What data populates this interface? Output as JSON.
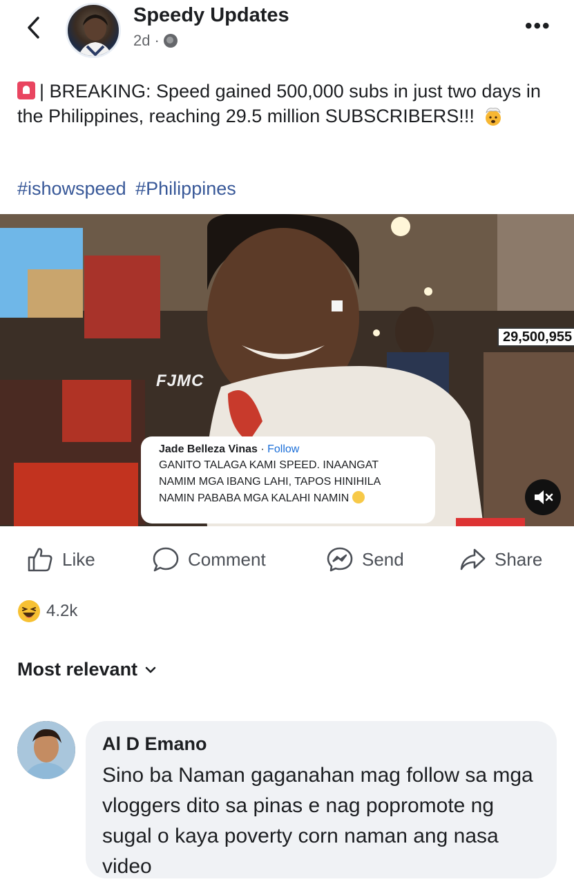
{
  "header": {
    "page_name": "Speedy Updates",
    "time": "2d",
    "separator": "·",
    "back_icon": "chevron-left-icon",
    "privacy_icon": "globe-icon",
    "more_label": "•••"
  },
  "post": {
    "text": "| BREAKING: Speed gained 500,000 subs in just two days in the Philippines, reaching 29.5 million SUBSCRIBERS!!!",
    "lead_icon": "siren-icon",
    "trail_icon": "mind-blown-emoji-icon",
    "hashtags": [
      "#ishowspeed",
      "#Philippines"
    ]
  },
  "video": {
    "subscriber_count": "29,500,955",
    "watermark": "FJMC",
    "overlay_comment": {
      "author": "Jade Belleza Vinas",
      "separator": " · ",
      "follow": "Follow",
      "lines": [
        "GANITO TALAGA KAMI SPEED. INAANGAT",
        "NAMIM MGA IBANG LAHI, TAPOS HINIHILA",
        "NAMIN PABABA MGA KALAHI NAMIN"
      ]
    },
    "mute_icon": "muted-speaker-icon"
  },
  "actions": {
    "like": "Like",
    "comment": "Comment",
    "send": "Send",
    "share": "Share"
  },
  "reactions": {
    "icon": "haha-emoji-icon",
    "count": "4.2k"
  },
  "comments": {
    "sort_label": "Most relevant",
    "items": [
      {
        "author": "Al D Emano",
        "text": "Sino ba Naman gaganahan mag follow sa mga vloggers dito sa pinas e nag popromote ng sugal o kaya poverty corn naman ang nasa video"
      }
    ]
  },
  "colors": {
    "link": "#385898",
    "follow": "#1a6ed8",
    "bubble": "#f0f2f5",
    "muted_text": "#65676b"
  }
}
